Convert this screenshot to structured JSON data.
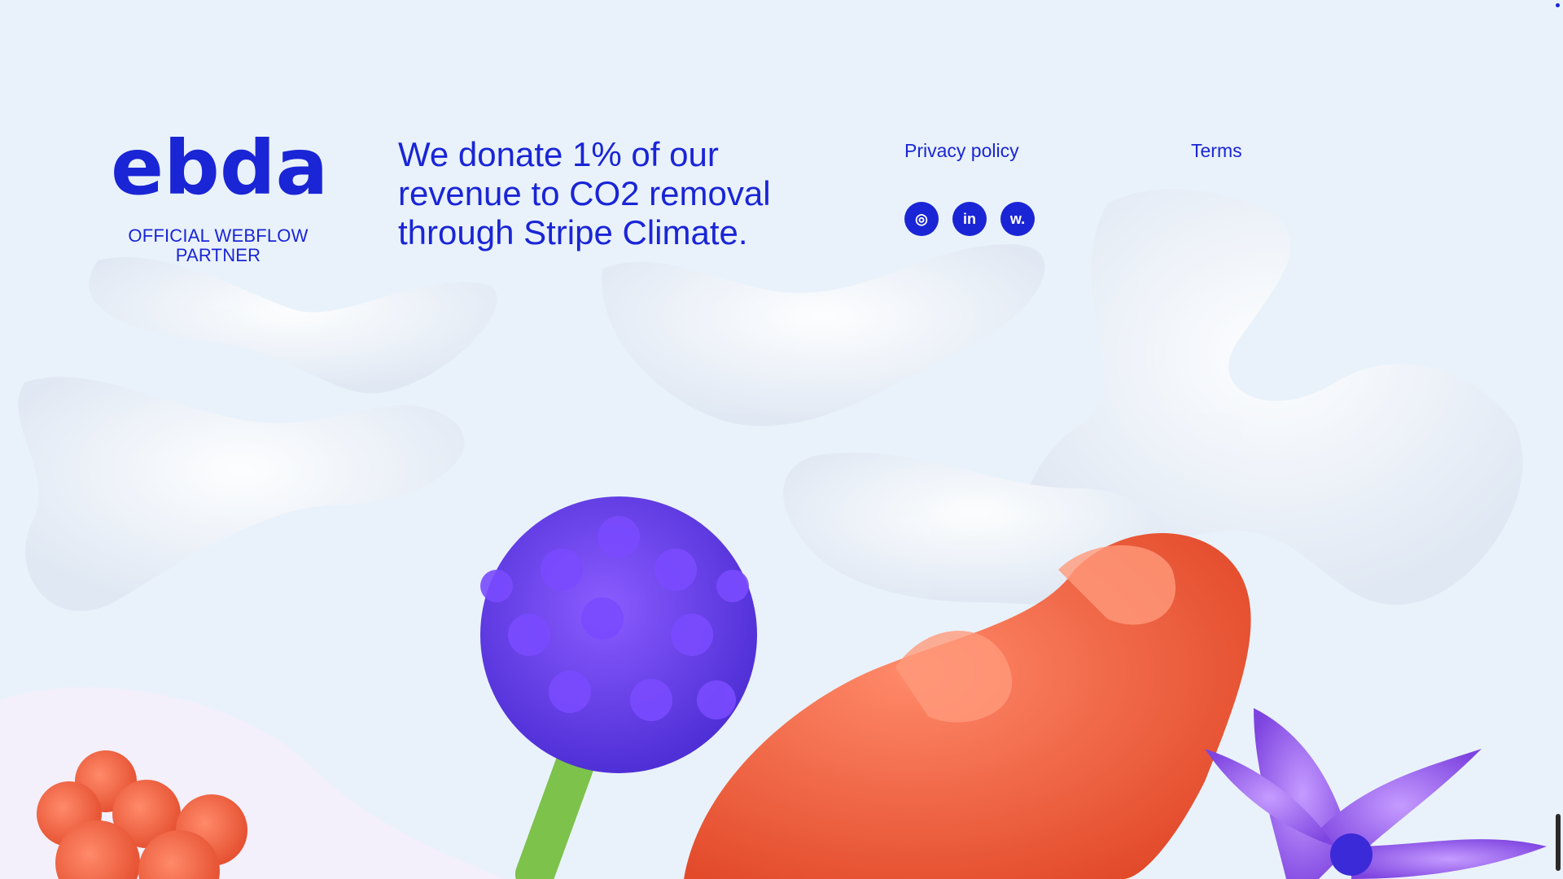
{
  "brand": {
    "logo_text": "ebda",
    "partner_label": "OFFICIAL WEBFLOW PARTNER"
  },
  "tagline": "We donate 1% of our revenue to CO2 removal through Stripe Climate.",
  "nav": {
    "privacy_label": "Privacy policy",
    "terms_label": "Terms"
  },
  "socials": [
    {
      "name": "instagram-icon",
      "glyph": "◎"
    },
    {
      "name": "linkedin-icon",
      "glyph": "in"
    },
    {
      "name": "webflow-icon",
      "glyph": "w."
    }
  ],
  "colors": {
    "brand_blue": "#1a25d6",
    "background": "#e9f2fa"
  }
}
